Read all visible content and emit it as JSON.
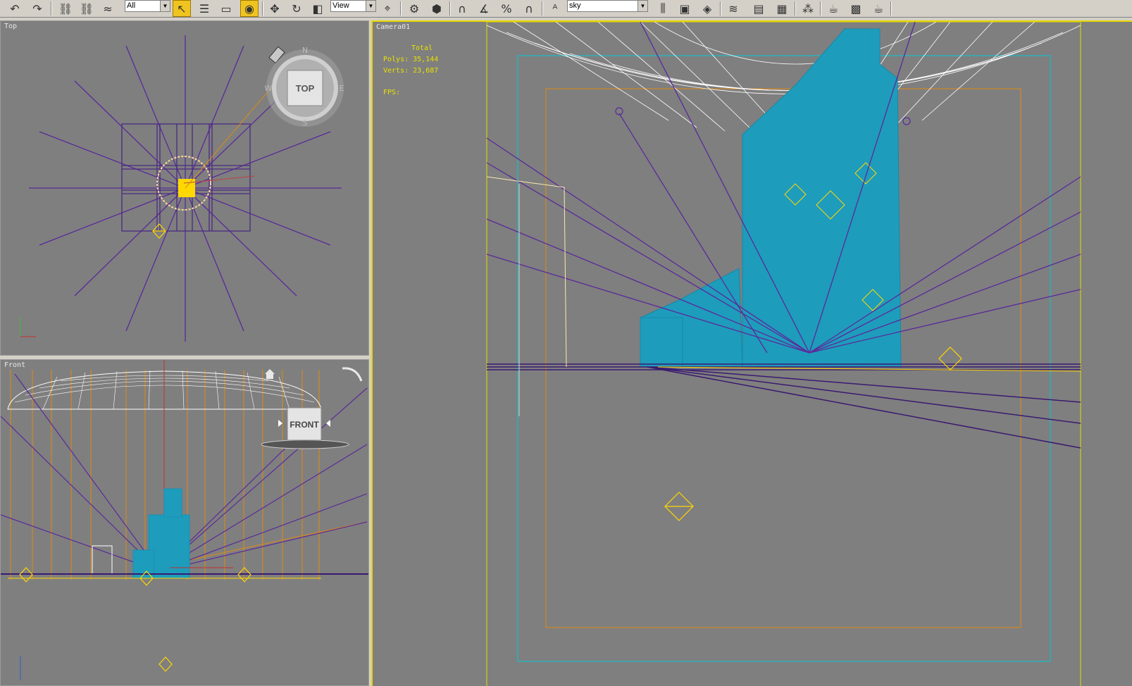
{
  "toolbar": {
    "selection_filter": "All",
    "ref_coord_system": "View",
    "named_selection": "sky",
    "buttons": [
      {
        "name": "undo-button",
        "glyph": "↶"
      },
      {
        "name": "redo-button",
        "glyph": "↷"
      },
      {
        "name": "select-and-link-button",
        "glyph": "⛓"
      },
      {
        "name": "unlink-selection-button",
        "glyph": "⛓"
      },
      {
        "name": "bind-to-space-warp-button",
        "glyph": "≈"
      },
      {
        "name": "select-object-button",
        "glyph": "↖"
      },
      {
        "name": "select-by-name-button",
        "glyph": "☰"
      },
      {
        "name": "rectangular-selection-button",
        "glyph": "▭"
      },
      {
        "name": "window-crossing-button",
        "glyph": "◉"
      },
      {
        "name": "select-and-move-button",
        "glyph": "✥"
      },
      {
        "name": "select-and-rotate-button",
        "glyph": "↻"
      },
      {
        "name": "select-and-scale-button",
        "glyph": "◧"
      },
      {
        "name": "use-pivot-center-button",
        "glyph": "⌖"
      },
      {
        "name": "select-and-manipulate-button",
        "glyph": "⚙"
      },
      {
        "name": "snap-toggle-button",
        "glyph": "∩"
      },
      {
        "name": "angle-snap-button",
        "glyph": "∡"
      },
      {
        "name": "percent-snap-button",
        "glyph": "%"
      },
      {
        "name": "spinner-snap-button",
        "glyph": "∩"
      },
      {
        "name": "edit-named-selection-button",
        "glyph": "ᴬ"
      },
      {
        "name": "mirror-button",
        "glyph": "⫼"
      },
      {
        "name": "align-button",
        "glyph": "▣"
      },
      {
        "name": "quick-align-button",
        "glyph": "◈"
      },
      {
        "name": "layer-manager-button",
        "glyph": "≋"
      },
      {
        "name": "curve-editor-button",
        "glyph": "▤"
      },
      {
        "name": "schematic-view-button",
        "glyph": "▦"
      },
      {
        "name": "material-editor-button",
        "glyph": "⁂"
      },
      {
        "name": "render-setup-button",
        "glyph": "☕"
      },
      {
        "name": "rendered-frame-window-button",
        "glyph": "▩"
      },
      {
        "name": "quick-render-button",
        "glyph": "☕"
      }
    ]
  },
  "viewports": {
    "top": {
      "label": "Top",
      "viewcube": "TOP",
      "compass": [
        "N",
        "E",
        "S",
        "W"
      ]
    },
    "front": {
      "label": "Front",
      "viewcube": "FRONT"
    },
    "camera": {
      "label": "Camera01",
      "stats": {
        "total": "Total",
        "polys": "Polys: 35,144",
        "verts": "Verts: 23,687",
        "fps": "FPS:"
      }
    }
  },
  "colors": {
    "viewport_bg": "#7f7f7f",
    "light": "#5a2a9a",
    "building": "#1e9cbc",
    "dome": "#ffffff",
    "selection": "#ffd800",
    "guide": "#e08a10",
    "safe_frame": "#00c8d8"
  }
}
